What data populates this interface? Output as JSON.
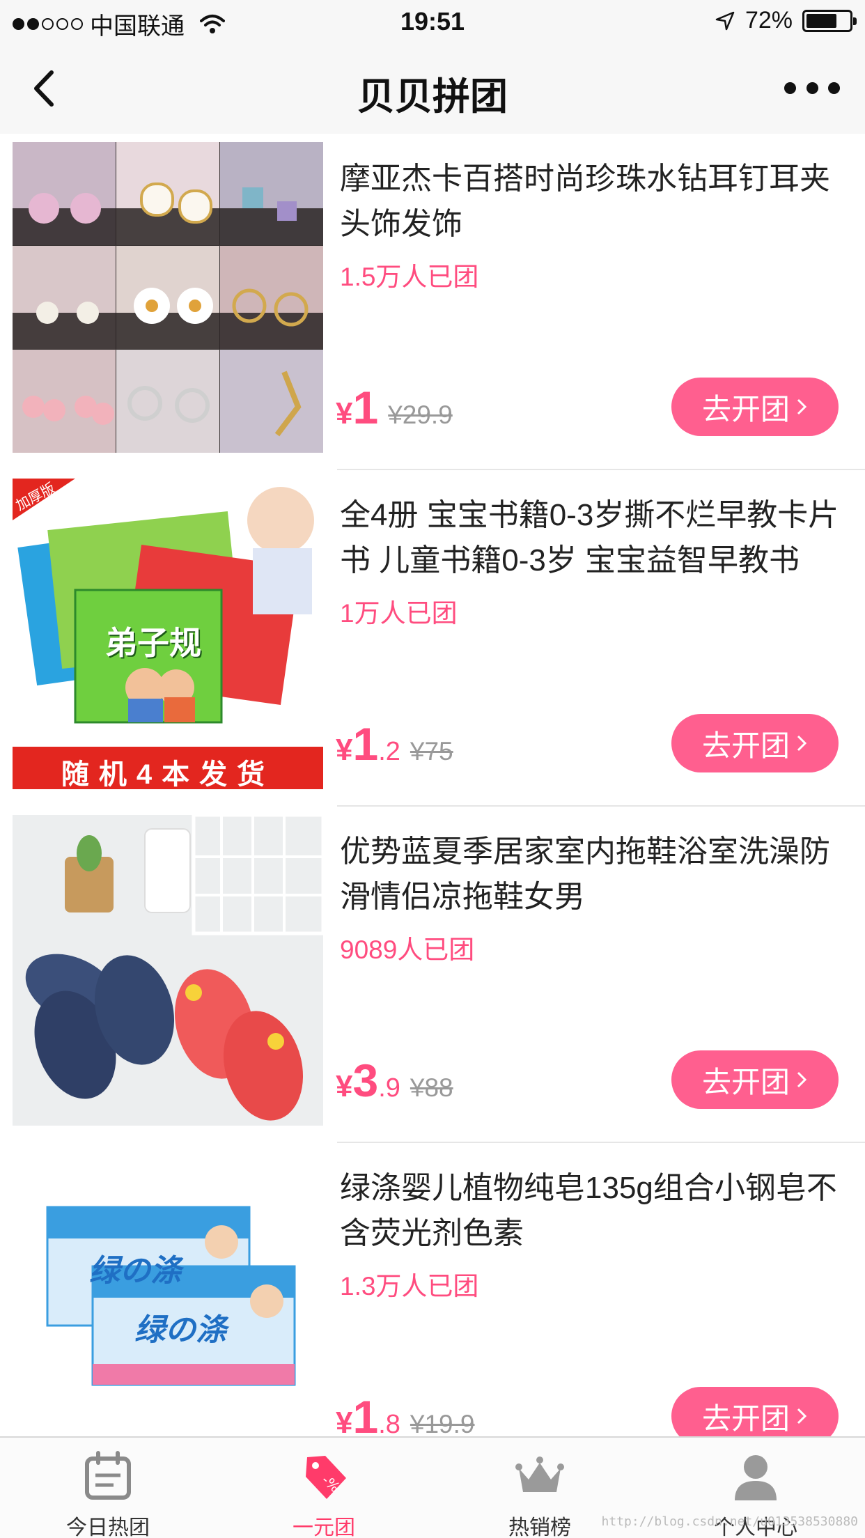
{
  "status_bar": {
    "carrier": "中国联通",
    "time": "19:51",
    "battery": "72%",
    "battery_level": 0.72,
    "signal_bars": 2
  },
  "nav": {
    "title": "贝贝拼团"
  },
  "products": [
    {
      "title": "摩亚杰卡百搭时尚珍珠水钻耳钉耳夹头饰发饰",
      "sold": "1.5万人已团",
      "currency": "¥",
      "price_int": "1",
      "price_dec": "",
      "original_price": "¥29.9",
      "button": "去开团",
      "image": "earrings-collage"
    },
    {
      "title": "全4册 宝宝书籍0-3岁撕不烂早教卡片书 儿童书籍0-3岁 宝宝益智早教书",
      "sold": "1万人已团",
      "currency": "¥",
      "price_int": "1",
      "price_dec": ".2",
      "original_price": "¥75",
      "button": "去开团",
      "image": "baby-books",
      "image_text": {
        "badge": "加厚版",
        "book": "弟子规",
        "banner": "随机4本发货"
      }
    },
    {
      "title": "优势蓝夏季居家室内拖鞋浴室洗澡防滑情侣凉拖鞋女男",
      "sold": "9089人已团",
      "currency": "¥",
      "price_int": "3",
      "price_dec": ".9",
      "original_price": "¥88",
      "button": "去开团",
      "image": "slippers"
    },
    {
      "title": "绿涤婴儿植物纯皂135g组合小钢皂不含荧光剂色素",
      "sold": "1.3万人已团",
      "currency": "¥",
      "price_int": "1",
      "price_dec": ".8",
      "original_price": "¥19.9",
      "button": "去开团",
      "image": "baby-soap",
      "image_text": {
        "brand": "绿の涤"
      }
    }
  ],
  "tabs": [
    {
      "label": "今日热团",
      "icon": "calendar-icon",
      "active": false
    },
    {
      "label": "一元团",
      "icon": "price-tag-icon",
      "active": true
    },
    {
      "label": "热销榜",
      "icon": "crown-icon",
      "active": false
    },
    {
      "label": "个人中心",
      "icon": "person-icon",
      "active": false
    }
  ],
  "watermark": "http://blog.csdn.net/u013538530880",
  "colors": {
    "accent": "#ff4c7f",
    "button": "#ff5f8f",
    "nav_bg": "#f7f7f7"
  }
}
